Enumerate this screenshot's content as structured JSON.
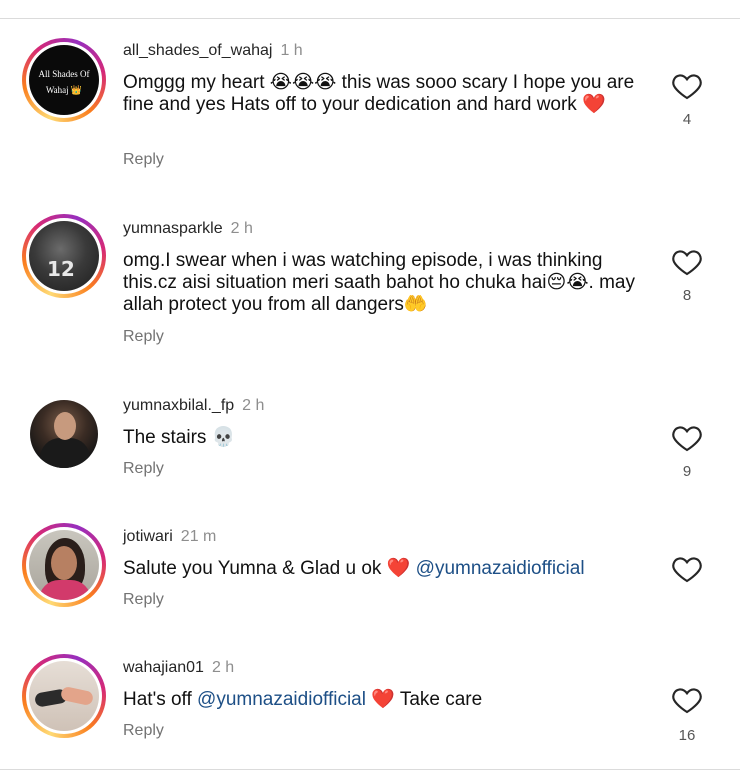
{
  "comments": [
    {
      "username": "all_shades_of_wahaj",
      "time": "1 h",
      "text": "Omggg my heart 😭😭😭 this was sooo scary I hope you are fine and yes Hats off to your dedication and hard work ❤️",
      "reply": "Reply",
      "likes": "4",
      "avatar_text_1": "All Shades Of",
      "avatar_text_2": "Wahaj 👑"
    },
    {
      "username": "yumnasparkle",
      "time": "2 h",
      "text": "omg.I swear when i was watching episode, i was thinking this.cz  aisi situation meri saath bahot ho chuka hai😔😭. may allah protect you from all dangers🤲",
      "reply": "Reply",
      "likes": "8",
      "avatar_text_1": "12"
    },
    {
      "username": "yumnaxbilal._fp",
      "time": "2 h",
      "text": "The stairs 💀",
      "reply": "Reply",
      "likes": "9"
    },
    {
      "username": "jotiwari",
      "time": "21 m",
      "text_before": "Salute you Yumna & Glad u ok ❤️ ",
      "mention": "@yumnazaidiofficial",
      "reply": "Reply"
    },
    {
      "username": "wahajian01",
      "time": "2 h",
      "text_before": "Hat's off ",
      "mention": "@yumnazaidiofficial",
      "text_after": " ❤️ Take care",
      "reply": "Reply",
      "likes": "16"
    }
  ],
  "icons": {
    "like": "heart-outline-icon"
  },
  "colors": {
    "mention": "#1d4f86",
    "muted": "#737373",
    "story_ring": "#d62976"
  }
}
